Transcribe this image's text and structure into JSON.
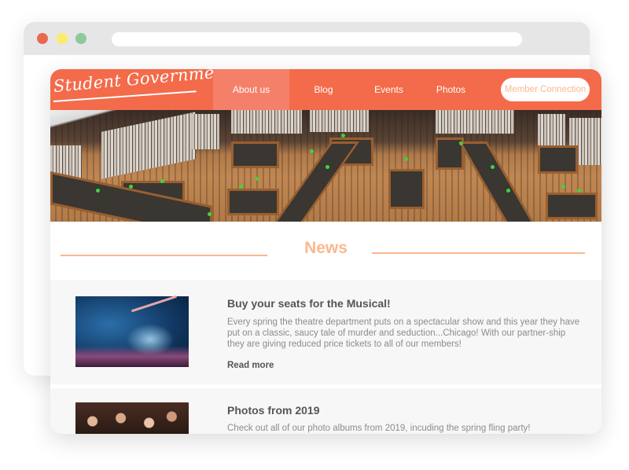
{
  "browser": {
    "window_controls": [
      "close",
      "minimize",
      "maximize"
    ],
    "colors": {
      "close": "#e8694f",
      "minimize": "#fbec6a",
      "maximize": "#8ec89b"
    }
  },
  "site": {
    "logo_text": "Student Government",
    "brand_color": "#f36b4a",
    "accent_color": "#fbb88e",
    "nav": {
      "items": [
        {
          "label": "About us",
          "active": true
        },
        {
          "label": "Blog",
          "active": false
        },
        {
          "label": "Events",
          "active": false
        },
        {
          "label": "Photos",
          "active": false
        }
      ],
      "cta_label": "Member Connection"
    },
    "hero": {
      "image": "library-reading-room"
    },
    "news": {
      "heading": "News",
      "items": [
        {
          "image": "concert-stage",
          "title": "Buy your seats for the Musical!",
          "body": "Every spring the theatre department puts on a spectacular show and this year they have put on a classic, saucy tale of murder and seduction...Chicago! With our partner-ship they are giving reduced price tickets to all of our members!",
          "link": "Read more"
        },
        {
          "image": "party-crowd",
          "title": "Photos from 2019",
          "body": "Check out all of our photo albums from 2019, incuding the spring fling party!"
        }
      ]
    }
  }
}
